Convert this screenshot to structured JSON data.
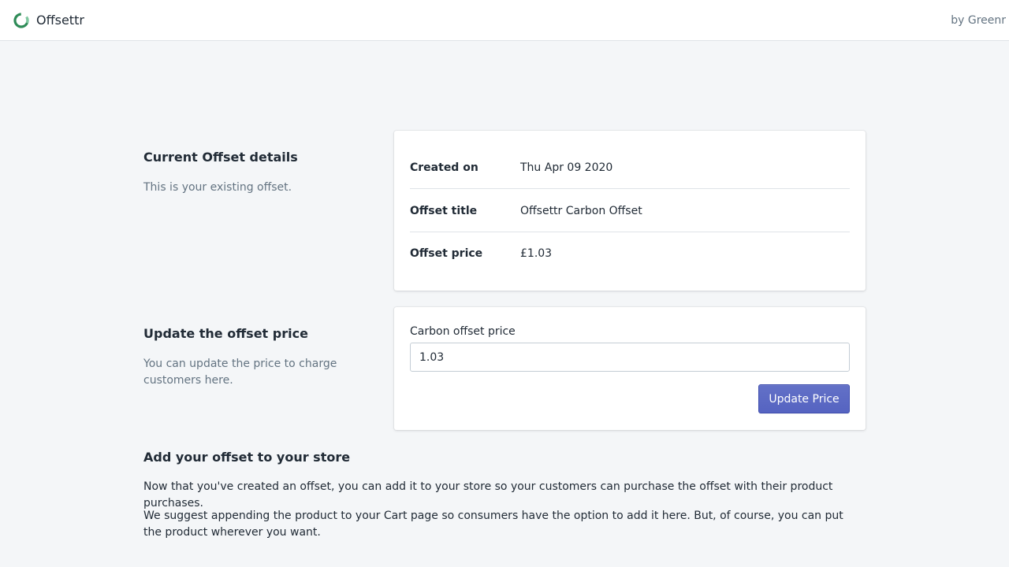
{
  "header": {
    "app_name": "Offsettr",
    "byline": "by Greenr",
    "logo_icon": "offsettr-ring-logo-icon",
    "brand_color": "#2e8b57"
  },
  "current_offset": {
    "title": "Current Offset details",
    "description": "This is your existing offset.",
    "rows": [
      {
        "term": "Created on",
        "value": "Thu Apr 09 2020"
      },
      {
        "term": "Offset title",
        "value": "Offsettr Carbon Offset"
      },
      {
        "term": "Offset price",
        "value": "£1.03"
      }
    ]
  },
  "update_price": {
    "title": "Update the offset price",
    "description": "You can update the price to charge customers here.",
    "field_label": "Carbon offset price",
    "field_value": "1.03",
    "button_label": "Update Price",
    "button_color": "#5c6ac4"
  },
  "add_to_store": {
    "title": "Add your offset to your store",
    "paragraphs": [
      "Now that you've created an offset, you can add it to your store so your customers can purchase the offset with their product purchases.",
      "We suggest appending the product to your Cart page so consumers have the option to add it here. But, of course, you can put the product wherever you want."
    ]
  }
}
